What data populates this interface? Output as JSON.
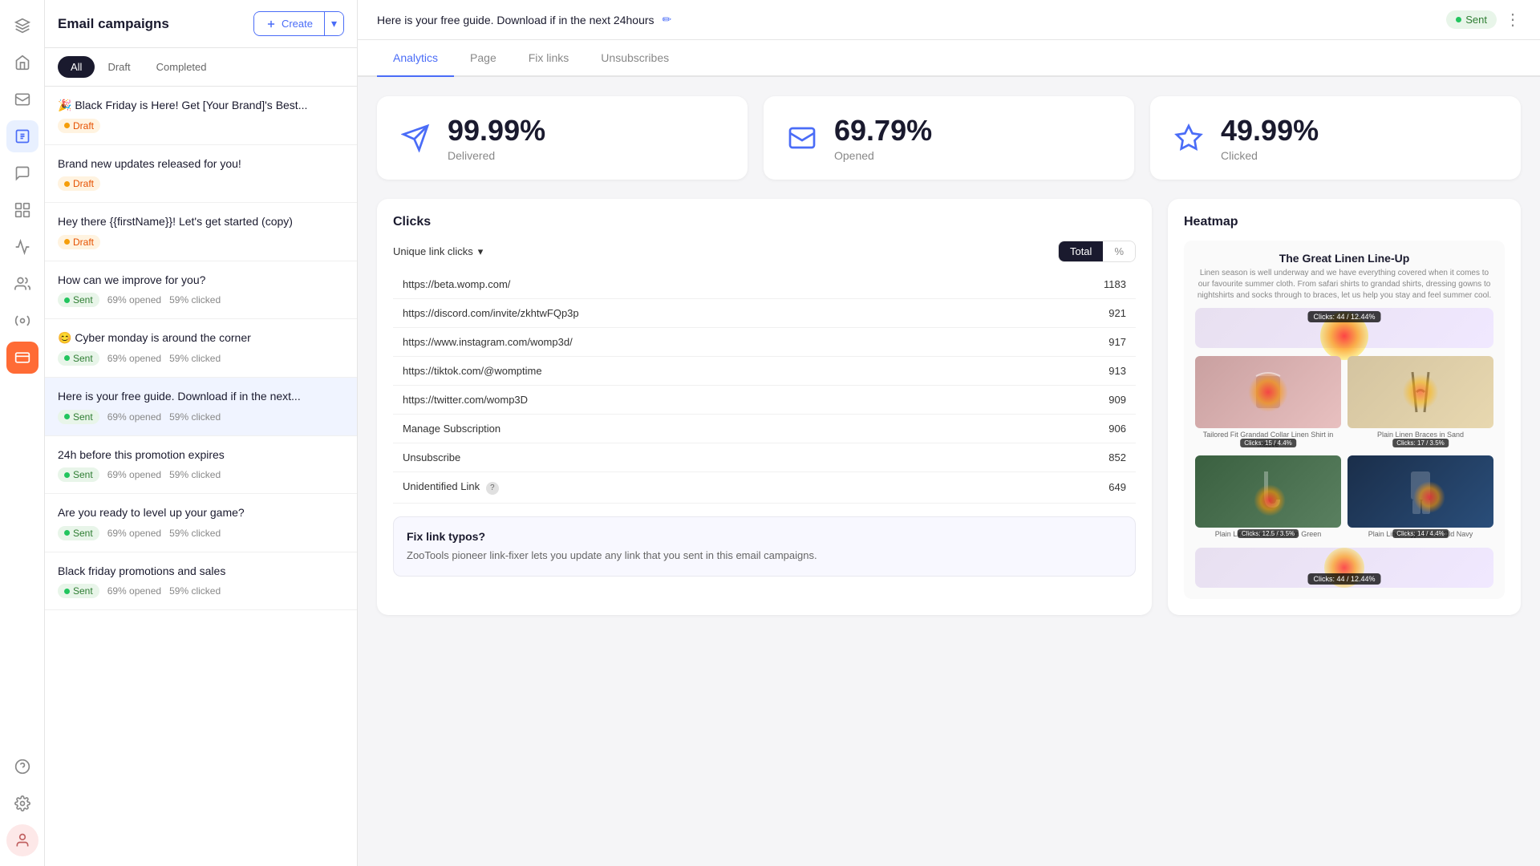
{
  "app": {
    "title": "Email campaigns"
  },
  "header": {
    "campaign_subject": "Here is your free guide. Download if in the next 24hours",
    "status": "Sent",
    "create_label": "Create"
  },
  "filter_tabs": [
    {
      "id": "all",
      "label": "All",
      "active": true
    },
    {
      "id": "draft",
      "label": "Draft",
      "active": false
    },
    {
      "id": "completed",
      "label": "Completed",
      "active": false
    }
  ],
  "campaigns": [
    {
      "title": "🎉 Black Friday is Here! Get [Your Brand]'s Best...",
      "status": "Draft",
      "status_type": "draft",
      "meta": ""
    },
    {
      "title": "Brand new updates released for you!",
      "status": "Draft",
      "status_type": "draft",
      "meta": ""
    },
    {
      "title": "Hey there {{firstName}}! Let's get started (copy)",
      "status": "Draft",
      "status_type": "draft",
      "meta": ""
    },
    {
      "title": "How can we improve for you?",
      "status": "Sent",
      "status_type": "sent",
      "opened": "69% opened",
      "clicked": "59% clicked"
    },
    {
      "title": "😊 Cyber monday is around the corner",
      "status": "Sent",
      "status_type": "sent",
      "opened": "69% opened",
      "clicked": "59% clicked"
    },
    {
      "title": "Here is your free guide. Download if in the next...",
      "status": "Sent",
      "status_type": "sent",
      "opened": "69% opened",
      "clicked": "59% clicked",
      "active": true
    },
    {
      "title": "24h before this promotion expires",
      "status": "Sent",
      "status_type": "sent",
      "opened": "69% opened",
      "clicked": "59% clicked"
    },
    {
      "title": "Are you ready to level up your game?",
      "status": "Sent",
      "status_type": "sent",
      "opened": "69% opened",
      "clicked": "59% clicked"
    },
    {
      "title": "Black friday promotions and sales",
      "status": "Sent",
      "status_type": "sent",
      "opened": "69% opened",
      "clicked": "59% clicked"
    }
  ],
  "main_tabs": [
    {
      "id": "analytics",
      "label": "Analytics",
      "active": true
    },
    {
      "id": "page",
      "label": "Page",
      "active": false
    },
    {
      "id": "fix-links",
      "label": "Fix links",
      "active": false
    },
    {
      "id": "unsubscribes",
      "label": "Unsubscribes",
      "active": false
    }
  ],
  "stats": [
    {
      "value": "99.99%",
      "label": "Delivered",
      "icon": "✈"
    },
    {
      "value": "69.79%",
      "label": "Opened",
      "icon": "✉"
    },
    {
      "value": "49.99%",
      "label": "Clicked",
      "icon": "✨"
    }
  ],
  "clicks": {
    "title": "Clicks",
    "unique_link_label": "Unique link clicks",
    "toggle": {
      "total": "Total",
      "percent": "%"
    },
    "links": [
      {
        "url": "https://beta.womp.com/",
        "count": 1183
      },
      {
        "url": "https://discord.com/invite/zkhtwFQp3p",
        "count": 921
      },
      {
        "url": "https://www.instagram.com/womp3d/",
        "count": 917
      },
      {
        "url": "https://tiktok.com/@womptime",
        "count": 913
      },
      {
        "url": "https://twitter.com/womp3D",
        "count": 909
      },
      {
        "url": "Manage Subscription",
        "count": 906
      },
      {
        "url": "Unsubscribe",
        "count": 852
      },
      {
        "url": "Unidentified Link",
        "count": 649
      }
    ],
    "fix_link_typos_title": "Fix link typos?",
    "fix_link_typos_desc": "ZooTools pioneer link-fixer lets you update any link that you sent in this email campaigns."
  },
  "heatmap": {
    "title": "Heatmap",
    "email_title": "The Great Linen Line-Up",
    "email_desc": "Linen season is well underway and we have everything covered when it comes to our favourite summer cloth. From safari shirts to grandad shirts, dressing gowns to nightshirts and socks through to braces, let us help you stay and feel summer cool.",
    "items": [
      {
        "label": "Tailored Fit Grandad Collar Linen Shirt in Mauve",
        "clicks": "Clicks: 15 / 4.4%",
        "color": "shirt-mauve"
      },
      {
        "label": "Plain Linen Braces in Sand",
        "clicks": "Clicks: 17 / 3.5%",
        "color": "shirt-sand"
      },
      {
        "label": "Plain Linen Short Socks in Green",
        "clicks": "Clicks: 12.5 / 3.5%",
        "color": "shirt-green"
      },
      {
        "label": "Plain Linen Pyjamas in Old Navy",
        "clicks": "Clicks: 14 / 4.4%",
        "color": "shirt-navy"
      }
    ],
    "top_clicks": "Clicks: 44 / 12.44%",
    "bottom_clicks": "Clicks: 44 / 12.44%"
  }
}
